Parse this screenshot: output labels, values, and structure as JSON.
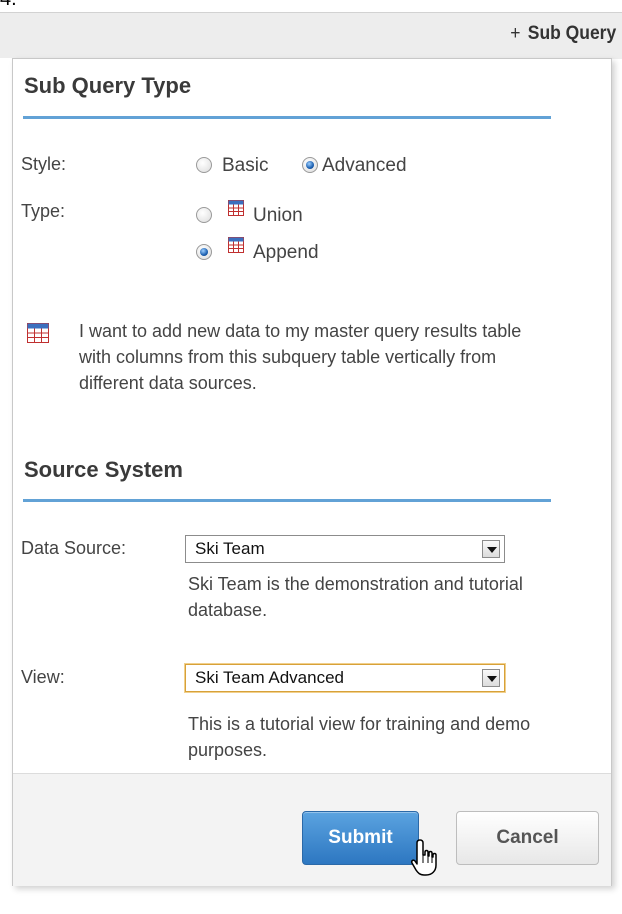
{
  "step": {
    "number": "4."
  },
  "toolbar": {
    "add_sub_query_label": "Sub Query",
    "plus_glyph": "+"
  },
  "panel": {
    "sub_query_type": {
      "title": "Sub Query Type",
      "style_label": "Style:",
      "style_options": [
        {
          "label": "Basic",
          "selected": false
        },
        {
          "label": "Advanced",
          "selected": true
        }
      ],
      "type_label": "Type:",
      "type_options": [
        {
          "label": "Union",
          "icon": "union-table-icon",
          "selected": false
        },
        {
          "label": "Append",
          "icon": "append-table-icon",
          "selected": true
        }
      ],
      "help_icon": "append-table-icon",
      "help_text": "I want to add new data to my master query results table with columns from this subquery table vertically from different data sources."
    },
    "source_system": {
      "title": "Source System",
      "data_source_label": "Data Source:",
      "data_source_value": "Ski Team",
      "data_source_description": "Ski Team is the demonstration and tutorial database.",
      "view_label": "View:",
      "view_value": "Ski Team Advanced",
      "view_description": "This is a tutorial view for training and demo purposes."
    },
    "buttons": {
      "submit_label": "Submit",
      "cancel_label": "Cancel"
    }
  },
  "colors": {
    "accent_rule": "#62a2d6",
    "submit_button": "#3b87cf",
    "focus_border": "#d7a13a"
  }
}
